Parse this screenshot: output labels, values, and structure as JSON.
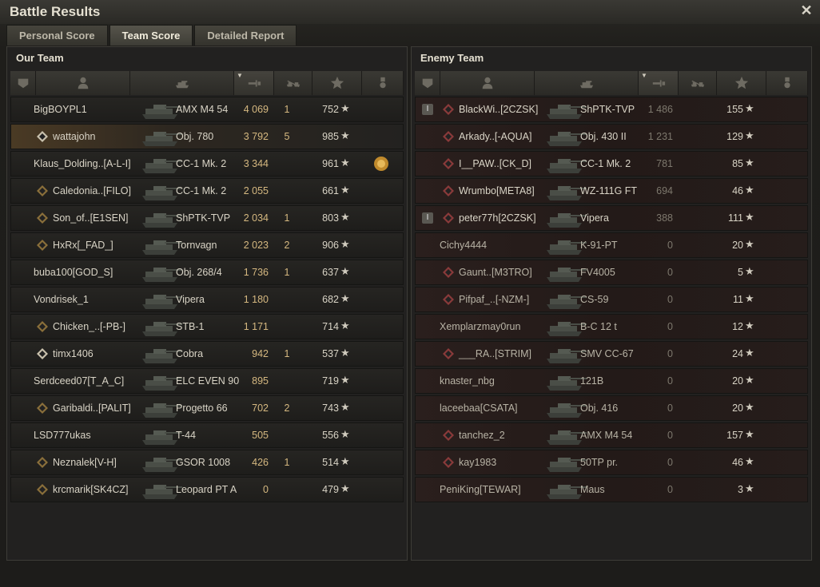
{
  "window": {
    "title": "Battle Results",
    "close_icon": "close-icon"
  },
  "tabs": [
    {
      "label": "Personal Score",
      "active": false
    },
    {
      "label": "Team Score",
      "active": true
    },
    {
      "label": "Detailed Report",
      "active": false
    }
  ],
  "columns": {
    "icons": [
      "platoon-icon",
      "player-icon",
      "tank-icon",
      "damage-icon",
      "kills-icon",
      "xp-star-icon",
      "medal-icon"
    ],
    "sorted": "damage"
  },
  "our_team": {
    "title": "Our Team",
    "rows": [
      {
        "name": "BigBOYPL1",
        "vehicle": "AMX M4 54",
        "damage": "4 069",
        "kills": "1",
        "xp": "752",
        "icon": "",
        "medal": false,
        "highlight": false
      },
      {
        "name": "wattajohn",
        "vehicle": "Obj. 780",
        "damage": "3 792",
        "kills": "5",
        "xp": "985",
        "icon": "rank",
        "medal": false,
        "highlight": true
      },
      {
        "name": "Klaus_Dolding..[A-L-I]",
        "vehicle": "CC-1 Mk. 2",
        "damage": "3 344",
        "kills": "",
        "xp": "961",
        "icon": "",
        "medal": true,
        "highlight": false
      },
      {
        "name": "Caledonia..[FILO]",
        "vehicle": "CC-1 Mk. 2",
        "damage": "2 055",
        "kills": "",
        "xp": "661",
        "icon": "clan",
        "medal": false,
        "highlight": false
      },
      {
        "name": "Son_of..[E1SEN]",
        "vehicle": "ShPTK-TVP",
        "damage": "2 034",
        "kills": "1",
        "xp": "803",
        "icon": "clan",
        "medal": false,
        "highlight": false
      },
      {
        "name": "HxRx[_FAD_]",
        "vehicle": "Tornvagn",
        "damage": "2 023",
        "kills": "2",
        "xp": "906",
        "icon": "clan",
        "medal": false,
        "highlight": false
      },
      {
        "name": "buba100[GOD_S]",
        "vehicle": "Obj. 268/4",
        "damage": "1 736",
        "kills": "1",
        "xp": "637",
        "icon": "",
        "medal": false,
        "highlight": false
      },
      {
        "name": "Vondrisek_1",
        "vehicle": "Vipera",
        "damage": "1 180",
        "kills": "",
        "xp": "682",
        "icon": "",
        "medal": false,
        "highlight": false
      },
      {
        "name": "Chicken_..[-PB-]",
        "vehicle": "STB-1",
        "damage": "1 171",
        "kills": "",
        "xp": "714",
        "icon": "clan",
        "medal": false,
        "highlight": false
      },
      {
        "name": "timx1406",
        "vehicle": "Cobra",
        "damage": "942",
        "kills": "1",
        "xp": "537",
        "icon": "rank",
        "medal": false,
        "highlight": false
      },
      {
        "name": "Serdceed07[T_A_C]",
        "vehicle": "ELC EVEN 90",
        "damage": "895",
        "kills": "",
        "xp": "719",
        "icon": "",
        "medal": false,
        "highlight": false
      },
      {
        "name": "Garibaldi..[PALIT]",
        "vehicle": "Progetto 66",
        "damage": "702",
        "kills": "2",
        "xp": "743",
        "icon": "clan",
        "medal": false,
        "highlight": false
      },
      {
        "name": "LSD777ukas",
        "vehicle": "T-44",
        "damage": "505",
        "kills": "",
        "xp": "556",
        "icon": "",
        "medal": false,
        "highlight": false
      },
      {
        "name": "Neznalek[V-H]",
        "vehicle": "GSOR 1008",
        "damage": "426",
        "kills": "1",
        "xp": "514",
        "icon": "clan",
        "medal": false,
        "highlight": false
      },
      {
        "name": "krcmarik[SK4CZ]",
        "vehicle": "Leopard PT A",
        "damage": "0",
        "kills": "",
        "xp": "479",
        "icon": "clan",
        "medal": false,
        "highlight": false
      }
    ]
  },
  "enemy_team": {
    "title": "Enemy Team",
    "rows": [
      {
        "name": "BlackWi..[2CZSK]",
        "vehicle": "ShPTK-TVP",
        "damage": "1 486",
        "xp": "155",
        "platoon": "I",
        "icon": "clan",
        "alive": true
      },
      {
        "name": "Arkady..[-AQUA]",
        "vehicle": "Obj. 430 II",
        "damage": "1 231",
        "xp": "129",
        "platoon": "",
        "icon": "clan",
        "alive": true
      },
      {
        "name": "I__PAW..[CK_D]",
        "vehicle": "CC-1 Mk. 2",
        "damage": "781",
        "xp": "85",
        "platoon": "",
        "icon": "clan",
        "alive": true
      },
      {
        "name": "Wrumbo[META8]",
        "vehicle": "WZ-111G FT",
        "damage": "694",
        "xp": "46",
        "platoon": "",
        "icon": "clan",
        "alive": true
      },
      {
        "name": "peter77h[2CZSK]",
        "vehicle": "Vipera",
        "damage": "388",
        "xp": "111",
        "platoon": "I",
        "icon": "clan",
        "alive": true
      },
      {
        "name": "Cichy4444",
        "vehicle": "K-91-PT",
        "damage": "0",
        "xp": "20",
        "platoon": "",
        "icon": "",
        "alive": false
      },
      {
        "name": "Gaunt..[M3TRO]",
        "vehicle": "FV4005",
        "damage": "0",
        "xp": "5",
        "platoon": "",
        "icon": "clan",
        "alive": false
      },
      {
        "name": "Pifpaf_..[-NZM-]",
        "vehicle": "CS-59",
        "damage": "0",
        "xp": "11",
        "platoon": "",
        "icon": "clan",
        "alive": false
      },
      {
        "name": "Xemplarzmay0run",
        "vehicle": "B-C 12 t",
        "damage": "0",
        "xp": "12",
        "platoon": "",
        "icon": "",
        "alive": false
      },
      {
        "name": "___RA..[STRIM]",
        "vehicle": "SMV CC-67",
        "damage": "0",
        "xp": "24",
        "platoon": "",
        "icon": "clan",
        "alive": false
      },
      {
        "name": "knaster_nbg",
        "vehicle": "121B",
        "damage": "0",
        "xp": "20",
        "platoon": "",
        "icon": "",
        "alive": false
      },
      {
        "name": "laceebaa[CSATA]",
        "vehicle": "Obj. 416",
        "damage": "0",
        "xp": "20",
        "platoon": "",
        "icon": "",
        "alive": false
      },
      {
        "name": "tanchez_2",
        "vehicle": "AMX M4 54",
        "damage": "0",
        "xp": "157",
        "platoon": "",
        "icon": "clan",
        "alive": false
      },
      {
        "name": "kay1983",
        "vehicle": "50TP pr.",
        "damage": "0",
        "xp": "46",
        "platoon": "",
        "icon": "clan",
        "alive": false
      },
      {
        "name": "PeniKing[TEWAR]",
        "vehicle": "Maus",
        "damage": "0",
        "xp": "3",
        "platoon": "",
        "icon": "",
        "alive": false
      }
    ]
  },
  "star_glyph": "★",
  "colors": {
    "damage_our": "#d5b880",
    "highlight": "#4a3a24",
    "enemy_row": "#2a1f1d"
  }
}
